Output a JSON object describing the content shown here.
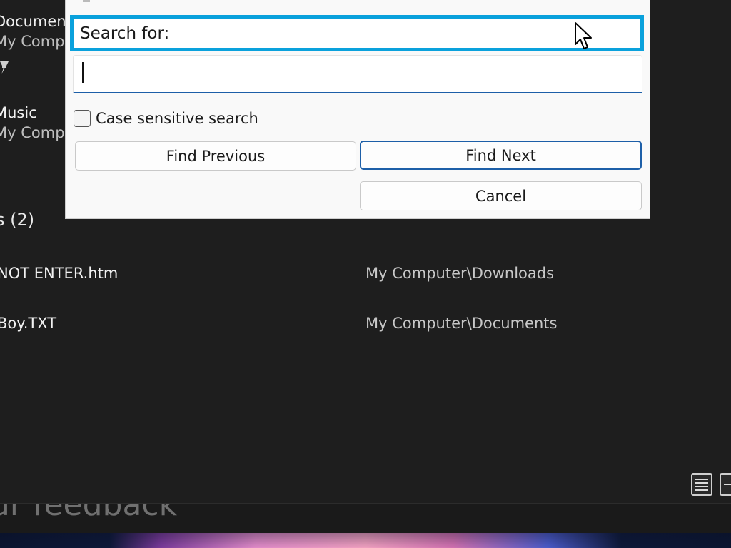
{
  "background": {
    "places": [
      {
        "name": "Documen",
        "sub": "My Comp"
      },
      {
        "name": "Music",
        "sub": "My Comp"
      }
    ],
    "section_header": "s (2)",
    "results": [
      {
        "name": "NOT ENTER.htm",
        "path": "My Computer\\Downloads"
      },
      {
        "name": "Boy.TXT",
        "path": "My Computer\\Documents"
      }
    ],
    "feedback": "ur feedback"
  },
  "dialog": {
    "search_label": "Search for:",
    "search_value": "",
    "case_sensitive_label": "Case sensitive search",
    "case_sensitive_checked": false,
    "find_previous": "Find Previous",
    "find_next": "Find Next",
    "cancel": "Cancel"
  },
  "colors": {
    "accent": "#0aa1dc",
    "focus_border": "#1d5fa8",
    "background": "#1e1e1e"
  },
  "icons": {
    "pin": "pin-icon",
    "details_view": "details-view-icon",
    "tiles_view": "tiles-view-icon",
    "cursor": "mouse-pointer-icon"
  }
}
